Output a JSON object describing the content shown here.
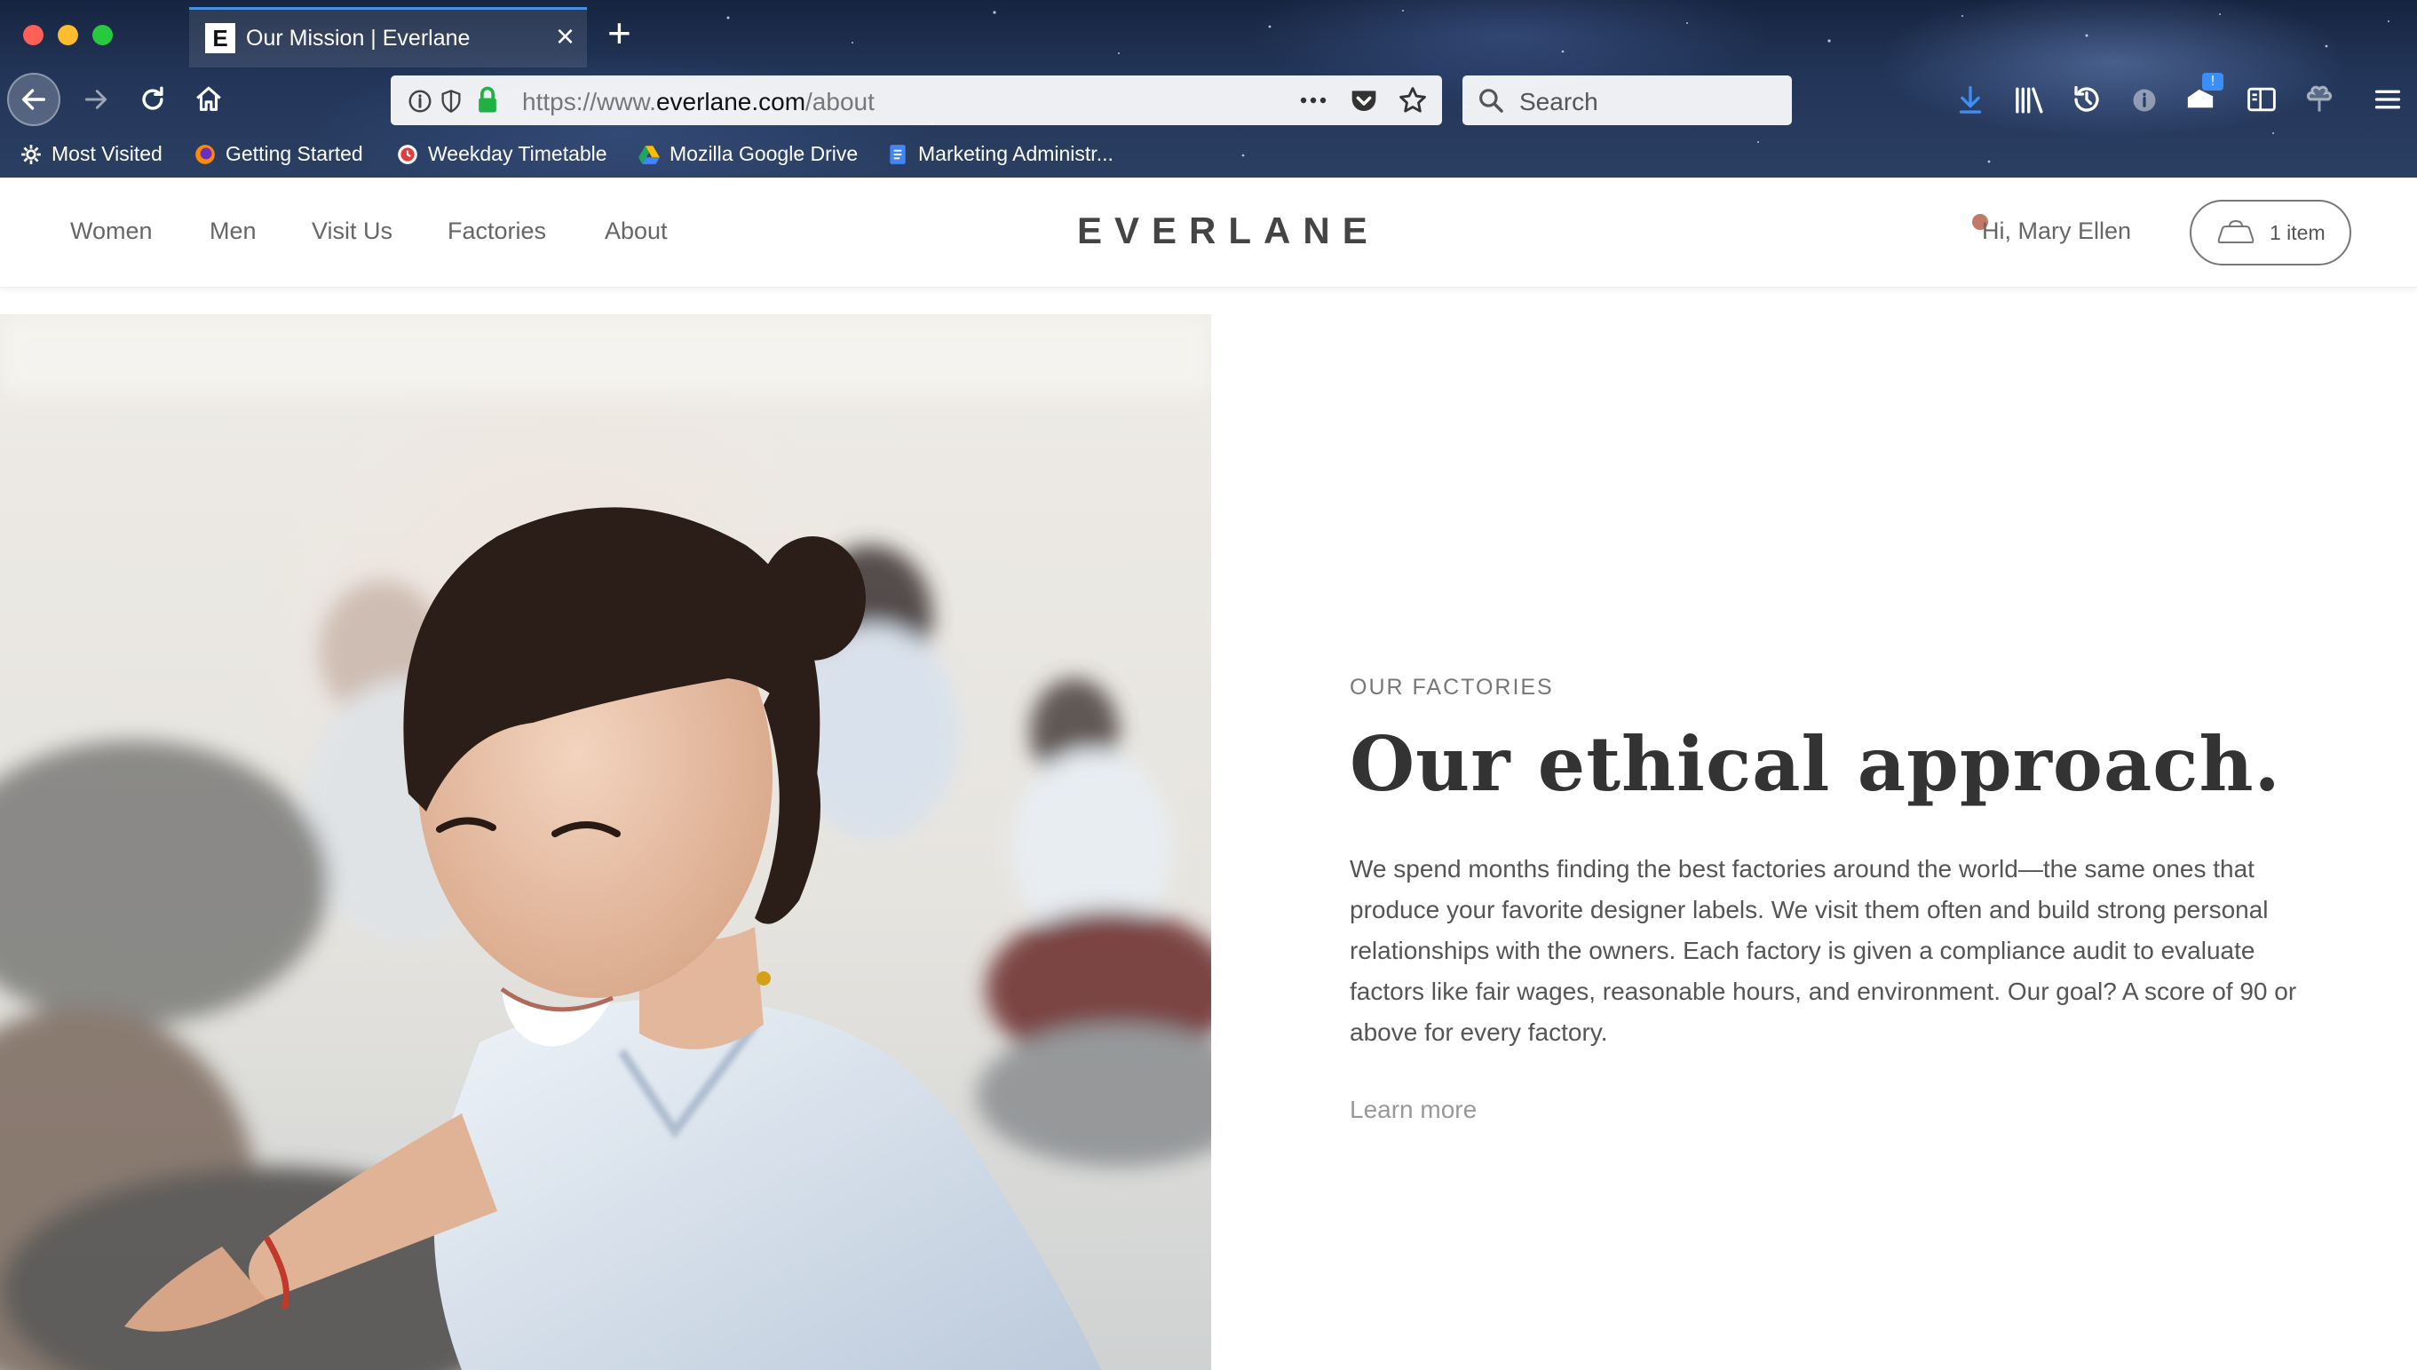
{
  "browser": {
    "tab_title": "Our Mission | Everlane",
    "tab_favicon": "E",
    "url_prefix": "https://www.",
    "url_domain": "everlane.com",
    "url_path": "/about",
    "search_placeholder": "Search",
    "traffic_light_colors": [
      "#fe5f57",
      "#febc2e",
      "#28c840"
    ],
    "accent_color": "#4a90e2",
    "icons": [
      "back-icon",
      "forward-icon",
      "reload-icon",
      "home-icon",
      "info-icon",
      "shield-icon",
      "lock-icon",
      "more-dots-icon",
      "pocket-icon",
      "star-icon",
      "search-icon",
      "download-icon",
      "library-icon",
      "history-icon",
      "info-circle-icon",
      "notifications-icon",
      "sidebar-icon",
      "clover-icon",
      "menu-icon"
    ],
    "bookmarks": [
      {
        "label": "Most Visited",
        "icon": "gear-icon"
      },
      {
        "label": "Getting Started",
        "icon": "firefox-icon"
      },
      {
        "label": "Weekday Timetable",
        "icon": "timetable-icon"
      },
      {
        "label": "Mozilla Google Drive",
        "icon": "drive-icon"
      },
      {
        "label": "Marketing Administr...",
        "icon": "docs-icon"
      }
    ]
  },
  "site": {
    "nav": [
      "Women",
      "Men",
      "Visit Us",
      "Factories",
      "About"
    ],
    "logo": "EVERLANE",
    "greeting": "Hi, Mary Ellen",
    "cart_label": "1 item",
    "cart_icon": "cart-icon"
  },
  "hero": {
    "eyebrow": "OUR FACTORIES",
    "headline": "Our ethical approach.",
    "body": "We spend months finding the best factories around the world—the same ones that produce your favorite designer labels. We visit them often and build strong personal relationships with the owners. Each factory is given a compliance audit to evaluate factors like fair wages, reasonable hours, and environment. Our goal? A score of 90 or above for every factory.",
    "link": "Learn more"
  }
}
